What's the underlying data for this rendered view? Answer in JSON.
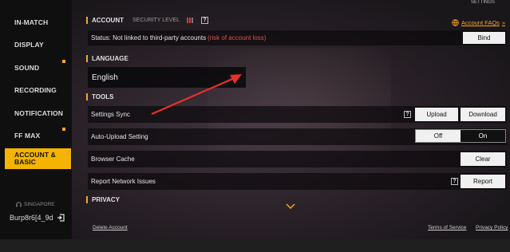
{
  "sidebar": {
    "items": [
      {
        "label": "IN-MATCH",
        "dot": false
      },
      {
        "label": "DISPLAY",
        "dot": false
      },
      {
        "label": "SOUND",
        "dot": true
      },
      {
        "label": "RECORDING",
        "dot": false
      },
      {
        "label": "NOTIFICATION",
        "dot": false
      },
      {
        "label": "FF MAX",
        "dot": true
      },
      {
        "label": "ACCOUNT &\nBASIC",
        "dot": true,
        "active": true
      }
    ],
    "region": "SINGAPORE",
    "username": "Burp8r6[4_9d"
  },
  "header": {
    "settings_label": "SETTINGS"
  },
  "account": {
    "title": "ACCOUNT",
    "security_level_label": "SECURITY LEVEL",
    "faq_label": "Account FAQs",
    "status_text": "Status:  Not linked to third-party accounts",
    "status_warning": "(risk of account loss)",
    "bind_label": "Bind"
  },
  "language": {
    "title": "LANGUAGE",
    "selected": "English"
  },
  "tools": {
    "title": "TOOLS",
    "settings_sync": {
      "label": "Settings Sync",
      "upload": "Upload",
      "download": "Download"
    },
    "auto_upload": {
      "label": "Auto-Upload Setting",
      "off": "Off",
      "on": "On",
      "selected": "On"
    },
    "browser_cache": {
      "label": "Browser Cache",
      "clear": "Clear"
    },
    "report_network": {
      "label": "Report Network Issues",
      "report": "Report"
    }
  },
  "privacy": {
    "title": "PRIVACY"
  },
  "footer": {
    "delete_account": "Delete Account",
    "terms": "Terms of Service",
    "privacy_policy": "Privacy Policy"
  },
  "colors": {
    "accent": "#f5a623",
    "active_nav": "#f5b400",
    "warning": "#e05050",
    "annotation_arrow": "#e8302a"
  }
}
